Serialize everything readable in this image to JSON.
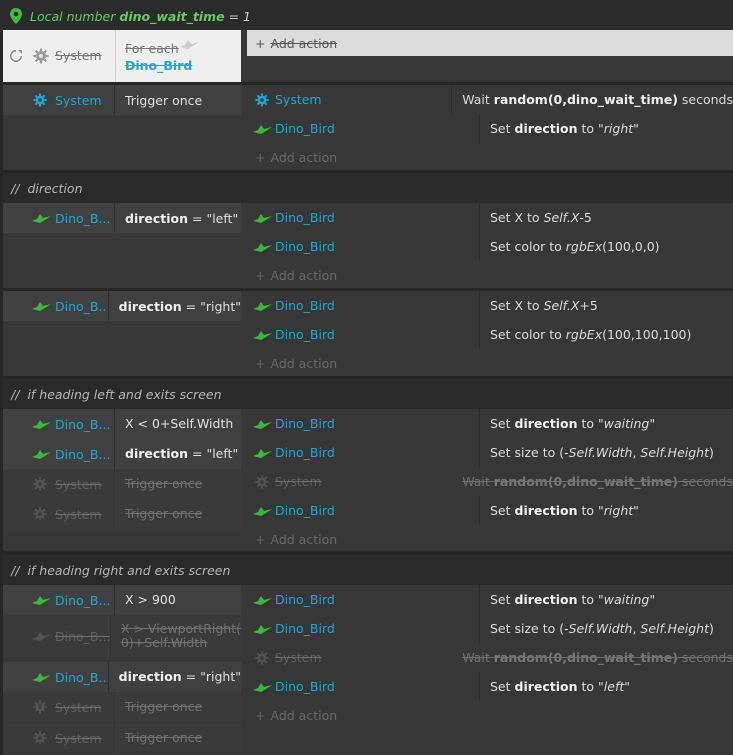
{
  "local_var": {
    "prefix": "Local number",
    "name": "dino_wait_time",
    "eq": "= 1"
  },
  "foreach": {
    "sys_label": "System",
    "line1": "For each",
    "line2": "Dino_Bird",
    "add_action": "Add action"
  },
  "events": [
    {
      "conditions": [
        {
          "obj": "System",
          "icon": "gear",
          "text_html": "Trigger once"
        }
      ],
      "actions": [
        {
          "obj": "System",
          "icon": "gear",
          "text_html": "Wait <b class='b'>random(0,dino_wait_time)</b> seconds"
        },
        {
          "obj": "Dino_Bird",
          "icon": "dino",
          "text_html": "Set <b class='b'>direction</b> to <span class='i'>\"right\"</span>"
        }
      ],
      "add_action": "Add action"
    }
  ],
  "comments": {
    "c1": "direction",
    "c2": "if heading left and exits screen",
    "c3": "if heading right and exits screen"
  },
  "ev_dir_left": {
    "cond": {
      "obj": "Dino_B...",
      "text_html": "<b class='b'>direction</b> = \"left\""
    },
    "actions": [
      {
        "obj": "Dino_Bird",
        "text_html": "Set X to <span class='i'>Self.X</span>-5"
      },
      {
        "obj": "Dino_Bird",
        "text_html": "Set color to <span class='i'>rgbEx</span>(100,0,0)"
      }
    ],
    "add_action": "Add action"
  },
  "ev_dir_right": {
    "cond": {
      "obj": "Dino_B...",
      "text_html": "<b class='b'>direction</b> = \"right\""
    },
    "actions": [
      {
        "obj": "Dino_Bird",
        "text_html": "Set X to <span class='i'>Self.X</span>+5"
      },
      {
        "obj": "Dino_Bird",
        "text_html": "Set color to <span class='i'>rgbEx</span>(100,100,100)"
      }
    ],
    "add_action": "Add action"
  },
  "ev_left_exit": {
    "conds": [
      {
        "obj": "Dino_B...",
        "icon": "dino",
        "text_html": "X &lt; 0+Self.Width",
        "disabled": false
      },
      {
        "obj": "Dino_B...",
        "icon": "dino",
        "text_html": "<b class='b'>direction</b> = \"left\"",
        "disabled": false
      },
      {
        "obj": "System",
        "icon": "gear",
        "text_html": "Trigger once",
        "disabled": true
      },
      {
        "obj": "System",
        "icon": "gear",
        "text_html": "Trigger once",
        "disabled": true
      }
    ],
    "actions": [
      {
        "obj": "Dino_Bird",
        "icon": "dino",
        "text_html": "Set <b class='b'>direction</b> to <span class='i'>\"waiting\"</span>",
        "disabled": false
      },
      {
        "obj": "Dino_Bird",
        "icon": "dino",
        "text_html": "Set size to (-<span class='i'>Self.Width</span>, <span class='i'>Self.Height</span>)",
        "disabled": false
      },
      {
        "obj": "System",
        "icon": "gear",
        "text_html": "Wait <b class='b'>random(0,dino_wait_time)</b> seconds",
        "disabled": true
      },
      {
        "obj": "Dino_Bird",
        "icon": "dino",
        "text_html": "Set <b class='b'>direction</b> to <span class='i'>\"right\"</span>",
        "disabled": false
      }
    ],
    "add_action": "Add action"
  },
  "ev_right_exit": {
    "conds": [
      {
        "obj": "Dino_B...",
        "icon": "dino",
        "text_html": "X &gt; 900",
        "disabled": false
      },
      {
        "obj": "Dino_B...",
        "icon": "dino",
        "text_html": "X &gt; ViewportRight(<br>0)+Self.Width",
        "disabled": true
      },
      {
        "obj": "Dino_B...",
        "icon": "dino",
        "text_html": "<b class='b'>direction</b> = \"right\"",
        "disabled": false
      },
      {
        "obj": "System",
        "icon": "gear",
        "text_html": "Trigger once",
        "disabled": true
      },
      {
        "obj": "System",
        "icon": "gear",
        "text_html": "Trigger once",
        "disabled": true
      }
    ],
    "actions": [
      {
        "obj": "Dino_Bird",
        "icon": "dino",
        "text_html": "Set <b class='b'>direction</b> to <span class='i'>\"waiting\"</span>",
        "disabled": false
      },
      {
        "obj": "Dino_Bird",
        "icon": "dino",
        "text_html": "Set size to (-<span class='i'>Self.Width</span>, <span class='i'>Self.Height</span>)",
        "disabled": false
      },
      {
        "obj": "System",
        "icon": "gear",
        "text_html": "Wait <b class='b'>random(0,dino_wait_time)</b> seconds",
        "disabled": true
      },
      {
        "obj": "Dino_Bird",
        "icon": "dino",
        "text_html": "Set <b class='b'>direction</b> to <span class='i'>\"left\"</span>",
        "disabled": false
      }
    ],
    "add_action": "Add action"
  },
  "colors": {
    "accent": "#1ea7d9",
    "local_var": "#5fcf5f",
    "dino": "#3cb83c"
  }
}
